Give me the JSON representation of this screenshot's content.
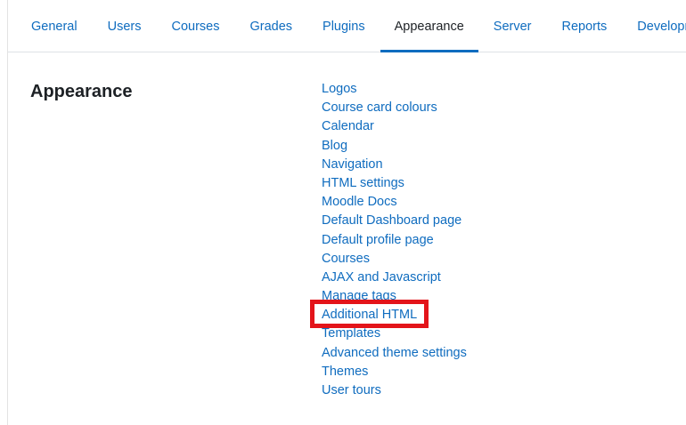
{
  "tabs": [
    {
      "label": "General",
      "active": false
    },
    {
      "label": "Users",
      "active": false
    },
    {
      "label": "Courses",
      "active": false
    },
    {
      "label": "Grades",
      "active": false
    },
    {
      "label": "Plugins",
      "active": false
    },
    {
      "label": "Appearance",
      "active": true
    },
    {
      "label": "Server",
      "active": false
    },
    {
      "label": "Reports",
      "active": false
    },
    {
      "label": "Development",
      "active": false
    }
  ],
  "section": {
    "heading": "Appearance",
    "links": [
      "Logos",
      "Course card colours",
      "Calendar",
      "Blog",
      "Navigation",
      "HTML settings",
      "Moodle Docs",
      "Default Dashboard page",
      "Default profile page",
      "Courses",
      "AJAX and Javascript",
      "Manage tags",
      "Additional HTML",
      "Templates",
      "Advanced theme settings",
      "Themes",
      "User tours"
    ],
    "highlighted_link": "Additional HTML"
  },
  "colors": {
    "link": "#0f6cbf",
    "text": "#1d2125",
    "active_underline": "#0f6cbf",
    "highlight_border": "#e3141a"
  }
}
